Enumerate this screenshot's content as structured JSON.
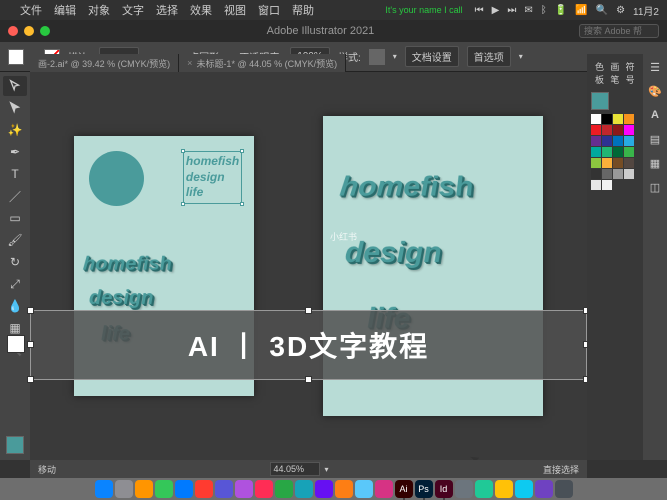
{
  "menubar": {
    "apple": "",
    "items": [
      "文件",
      "编辑",
      "对象",
      "文字",
      "选择",
      "效果",
      "视图",
      "窗口",
      "帮助"
    ],
    "status_text": "It's your name I call",
    "date": "11月2"
  },
  "titlebar": {
    "title": "Adobe Illustrator 2021",
    "search_placeholder": "搜索 Adobe 帮"
  },
  "controlbar": {
    "stroke_label": "描边:",
    "brush_label": "5 点圆形",
    "opacity_label": "不透明度:",
    "opacity_value": "100%",
    "style_label": "样式:",
    "doc_setup": "文档设置",
    "prefs": "首选项"
  },
  "tabs": [
    {
      "label": "画-2.ai* @ 39.42 % (CMYK/预览)"
    },
    {
      "label": "未标题-1* @ 44.05 % (CMYK/预览)"
    }
  ],
  "artboard1": {
    "text_lines": [
      "homefish",
      "design",
      "life"
    ]
  },
  "artboard2": {
    "text_lines": [
      "homefish",
      "design",
      "life"
    ]
  },
  "watermark": "小红书",
  "overlay": {
    "text": "AI 丨 3D文字教程"
  },
  "status": {
    "left": "移动",
    "zoom": "44.05%",
    "right": "直接选择"
  },
  "panels": {
    "tabs": [
      "色板",
      "画笔",
      "符号"
    ]
  },
  "swatch_colors": [
    "#fff",
    "#000",
    "#e8e337",
    "#f7931e",
    "#ed1c24",
    "#c1272d",
    "#8b1a1a",
    "#ff00ff",
    "#662d91",
    "#2e3192",
    "#0071bc",
    "#29abe2",
    "#00a99d",
    "#22b573",
    "#006837",
    "#39b54a",
    "#8cc63f",
    "#fbb03b",
    "#754c24",
    "#534741",
    "#333",
    "#666",
    "#999",
    "#ccc",
    "#e6e6e6",
    "#f2f2f2"
  ],
  "dock_apps": [
    {
      "c": "#0a84ff",
      "t": ""
    },
    {
      "c": "#8e8e93",
      "t": ""
    },
    {
      "c": "#ff9500",
      "t": ""
    },
    {
      "c": "#34c759",
      "t": ""
    },
    {
      "c": "#007aff",
      "t": ""
    },
    {
      "c": "#ff3b30",
      "t": ""
    },
    {
      "c": "#5856d6",
      "t": ""
    },
    {
      "c": "#af52de",
      "t": ""
    },
    {
      "c": "#ff2d55",
      "t": ""
    },
    {
      "c": "#28a745",
      "t": ""
    },
    {
      "c": "#17a2b8",
      "t": ""
    },
    {
      "c": "#6610f2",
      "t": ""
    },
    {
      "c": "#fd7e14",
      "t": ""
    },
    {
      "c": "#5ac8fa",
      "t": ""
    },
    {
      "c": "#d63384",
      "t": ""
    },
    {
      "c": "#330000",
      "t": "Ai"
    },
    {
      "c": "#001e36",
      "t": "Ps"
    },
    {
      "c": "#49021f",
      "t": "Id"
    },
    {
      "c": "#6c757d",
      "t": ""
    },
    {
      "c": "#20c997",
      "t": ""
    },
    {
      "c": "#ffc107",
      "t": ""
    },
    {
      "c": "#0dcaf0",
      "t": ""
    },
    {
      "c": "#6f42c1",
      "t": ""
    },
    {
      "c": "#495057",
      "t": ""
    }
  ],
  "chart_data": null
}
